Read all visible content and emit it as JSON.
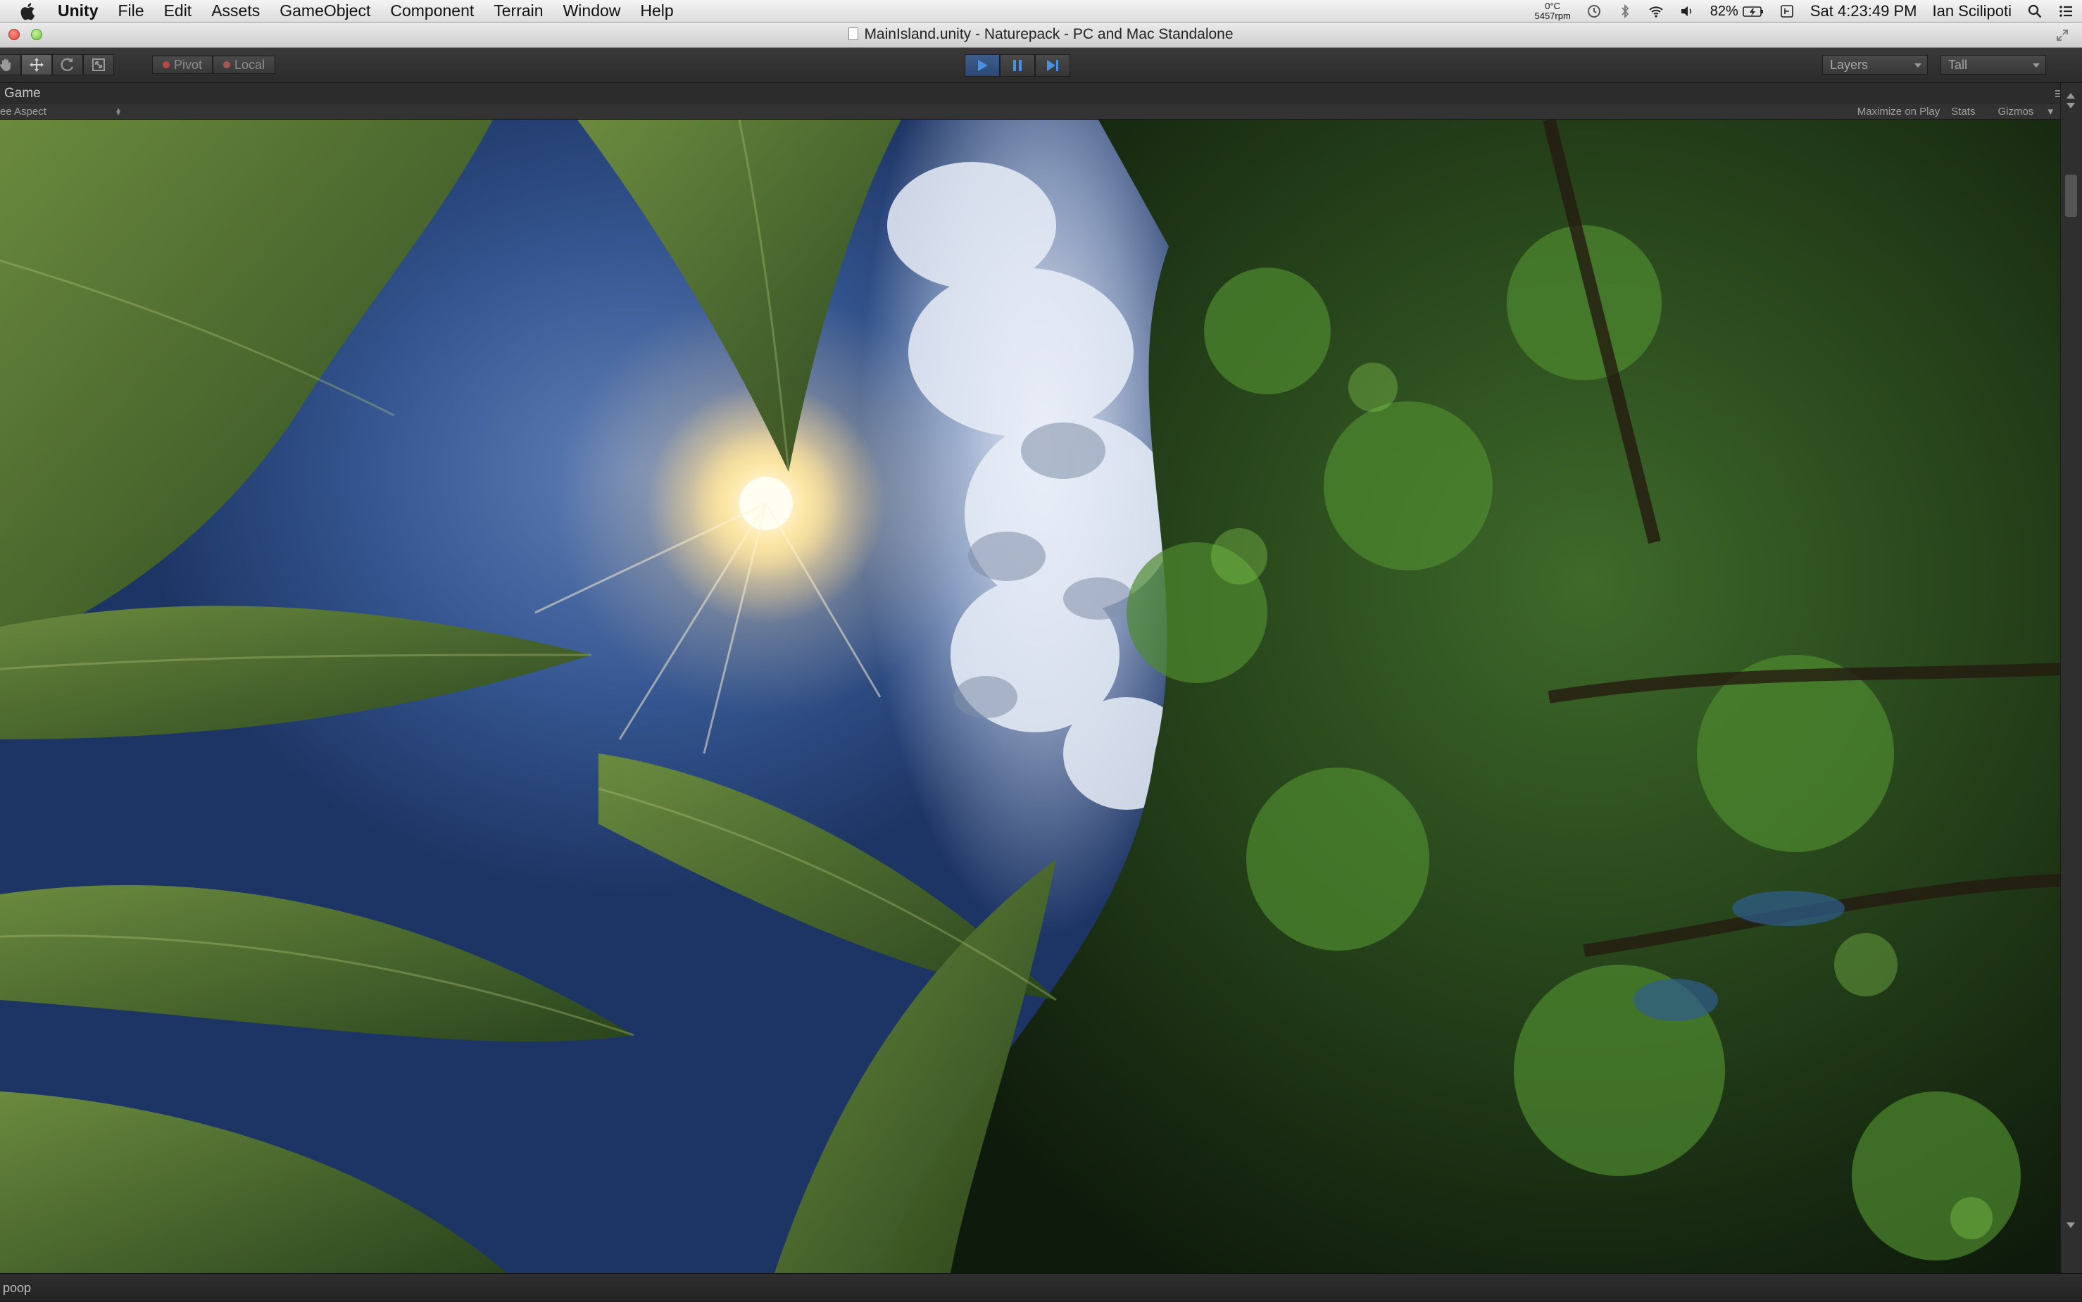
{
  "menubar": {
    "apple_icon": "apple-icon",
    "app_name": "Unity",
    "items": [
      "File",
      "Edit",
      "Assets",
      "GameObject",
      "Component",
      "Terrain",
      "Window",
      "Help"
    ],
    "status": {
      "temperature": "0°C",
      "fan_speed": "5457rpm",
      "battery_percent": "82%",
      "clock": "Sat 4:23:49 PM",
      "user": "Ian Scilipoti"
    }
  },
  "window": {
    "title": "MainIsland.unity - Naturepack - PC and Mac Standalone"
  },
  "toolbar": {
    "pivot_label": "Pivot",
    "local_label": "Local",
    "layers_label": "Layers",
    "layout_label": "Tall",
    "play_state": "playing"
  },
  "game_view": {
    "tab_label": "Game",
    "aspect_label": "ee Aspect",
    "maximize_label": "Maximize on Play",
    "stats_label": "Stats",
    "gizmos_label": "Gizmos"
  },
  "statusbar": {
    "message": "poop"
  },
  "colors": {
    "unity_dark": "#2c2c2c",
    "play_active": "#2b4876",
    "play_icon": "#4a90e2"
  }
}
